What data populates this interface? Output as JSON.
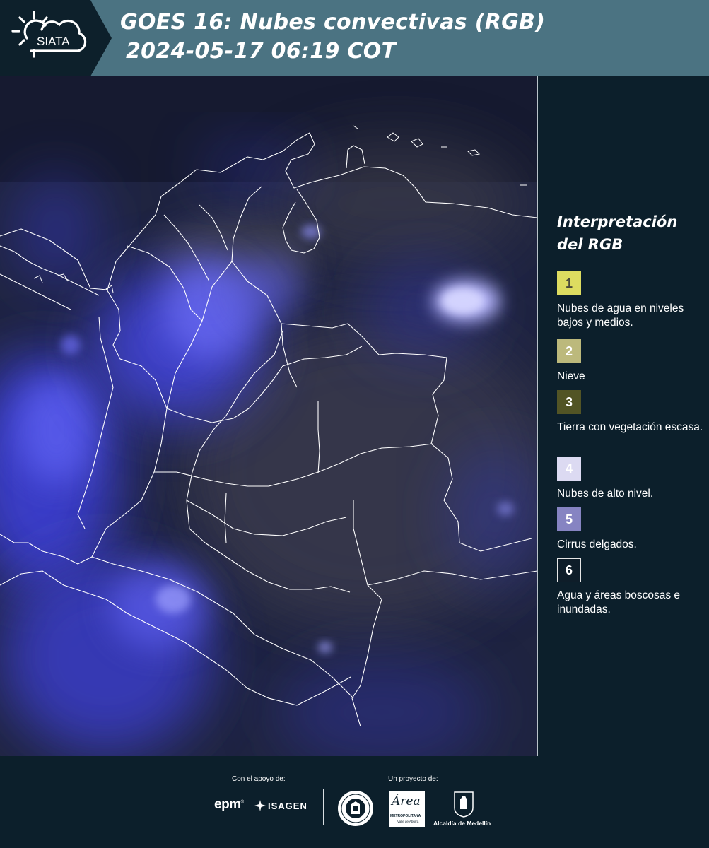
{
  "header": {
    "logo_text": "SIATA",
    "title_line1": "GOES 16: Nubes convectivas (RGB)",
    "title_line2": "2024-05-17 06:19 COT"
  },
  "map": {
    "description_icon": "satellite-rgb-image",
    "boundary_color": "#ffffff"
  },
  "legend": {
    "title": "Interpretación del RGB",
    "items": [
      {
        "number": "1",
        "label": "Nubes de agua en niveles bajos y medios.",
        "color": "#dddc60",
        "text_color": "#4a4a3a"
      },
      {
        "number": "2",
        "label": "Nieve",
        "color": "#bcb97c",
        "text_color": "#ffffff"
      },
      {
        "number": "3",
        "label": "Tierra con vegetación escasa.",
        "color": "#525425",
        "text_color": "#ffffff"
      },
      {
        "number": "4",
        "label": "Nubes de alto nivel.",
        "color": "#dcdaf2",
        "text_color": "#ffffff"
      },
      {
        "number": "5",
        "label": "Cirrus delgados.",
        "color": "#8684c2",
        "text_color": "#ffffff"
      },
      {
        "number": "6",
        "label": "Agua y áreas boscosas e inundadas.",
        "color": "#0e1d29",
        "text_color": "#ffffff"
      }
    ]
  },
  "footer": {
    "support_caption": "Con el apoyo de:",
    "project_caption": "Un proyecto de:",
    "epm": "epm",
    "isagen": "ISAGEN",
    "area_word": "Área",
    "area_sub1": "METROPOLITANA",
    "area_sub2": "Valle de Aburrá",
    "alcaldia": "Alcaldía de Medellín"
  }
}
